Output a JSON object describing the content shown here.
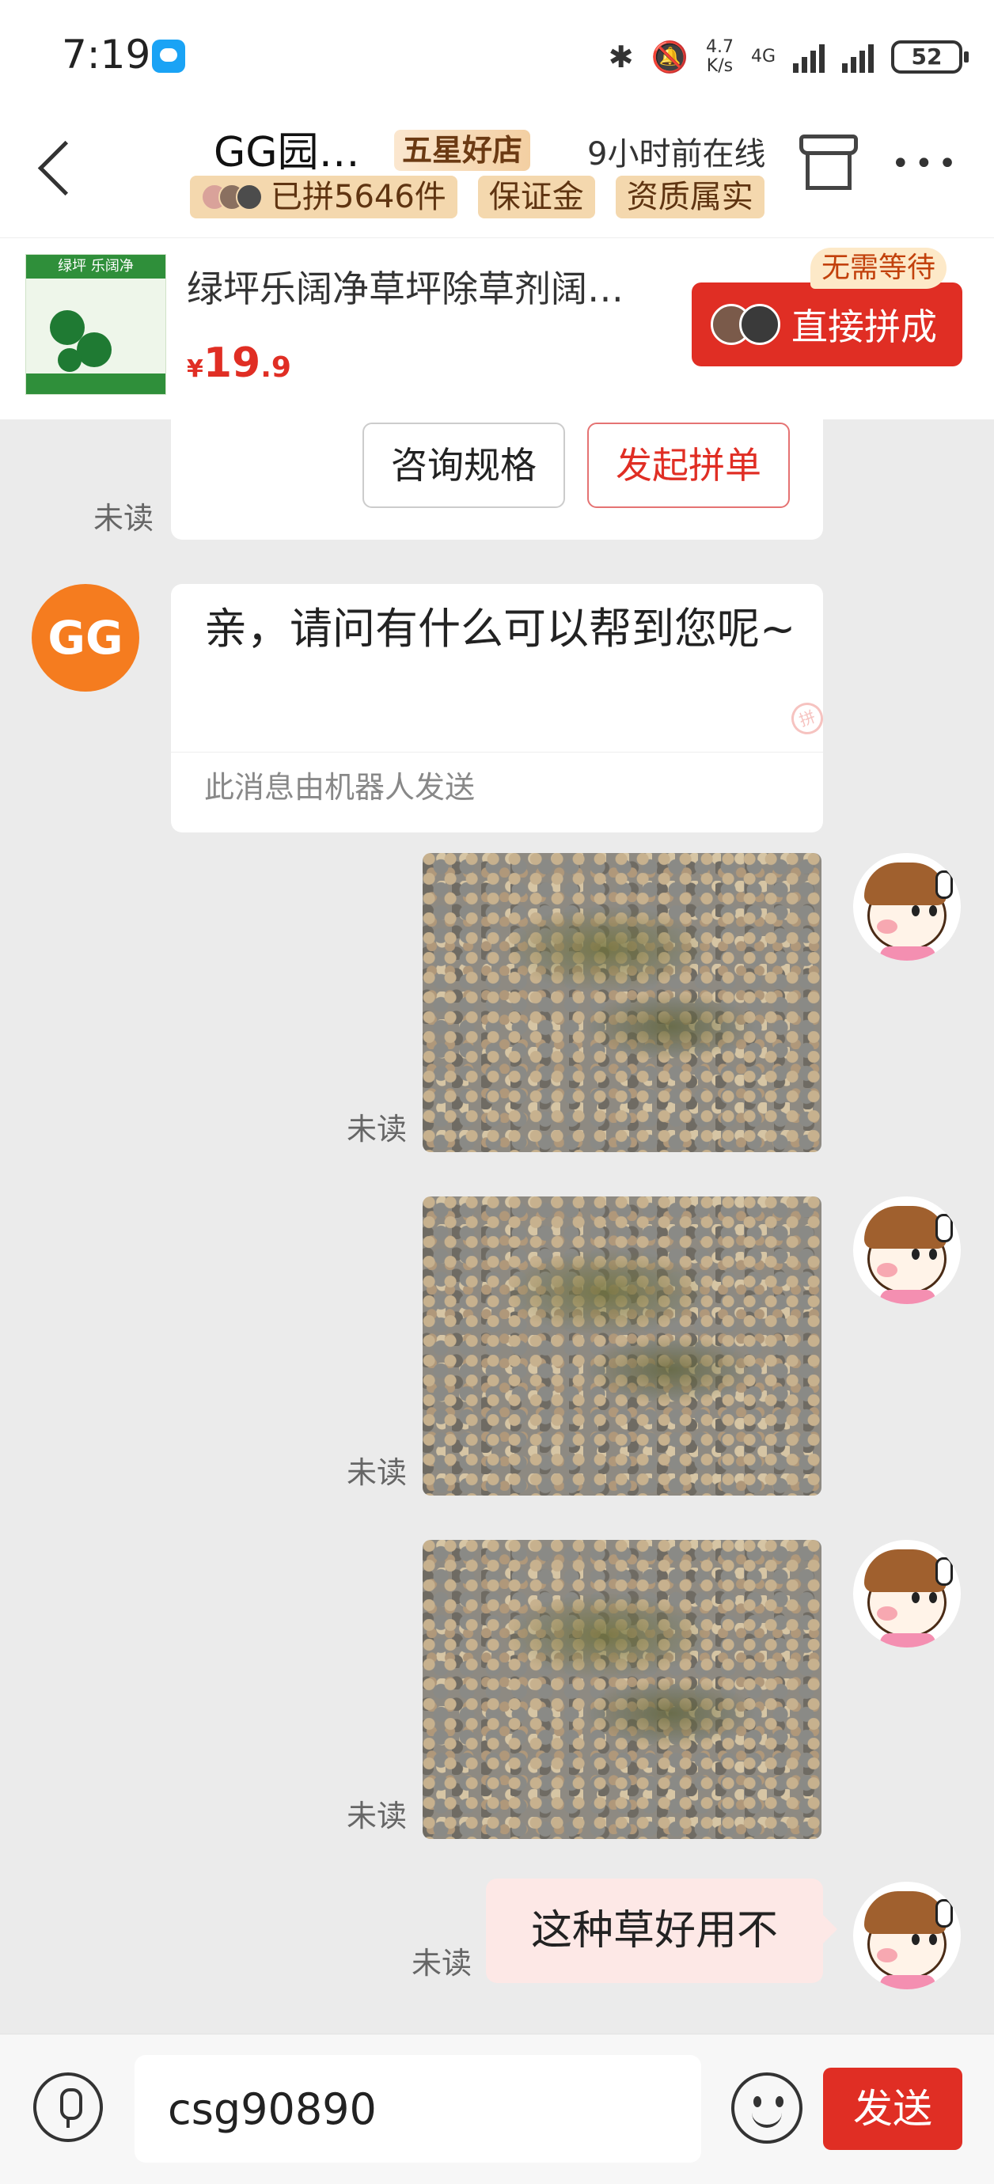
{
  "status_bar": {
    "time": "7:19",
    "speed_value": "4.7",
    "speed_unit": "K/s",
    "network": "4G",
    "battery": "52",
    "icons": [
      "message-app-icon",
      "bluetooth-icon",
      "mute-icon",
      "signal-icon",
      "battery-icon"
    ]
  },
  "header": {
    "shop_name": "GG园…",
    "badge": "五星好店",
    "online_status": "9小时前在线",
    "tags": [
      "已拼5646件",
      "保证金",
      "资质属实"
    ],
    "more": "•••"
  },
  "product": {
    "title": "绿坪乐阔净草坪除草剂阔…",
    "currency": "¥",
    "price_int": "19",
    "price_dec": ".9",
    "buy_label": "直接拼成",
    "no_wait_label": "无需等待",
    "thumb_brand": "绿坪 乐阔净"
  },
  "chat": {
    "card_buttons": {
      "consult": "咨询规格",
      "group_buy": "发起拼单"
    },
    "unread_label": "未读",
    "shop_avatar_text": "GG",
    "bot_message": "亲，请问有什么可以帮到您呢~",
    "bot_note": "此消息由机器人发送",
    "watermark": "拼",
    "user_text_message": "这种草好用不"
  },
  "composer": {
    "input_value": "csg90890",
    "send_label": "发送"
  },
  "colors": {
    "accent_red": "#e02e24",
    "shop_avatar_orange": "#f57c1f",
    "chat_background": "#ebebeb",
    "badge_gold": "#f4d8ae"
  }
}
